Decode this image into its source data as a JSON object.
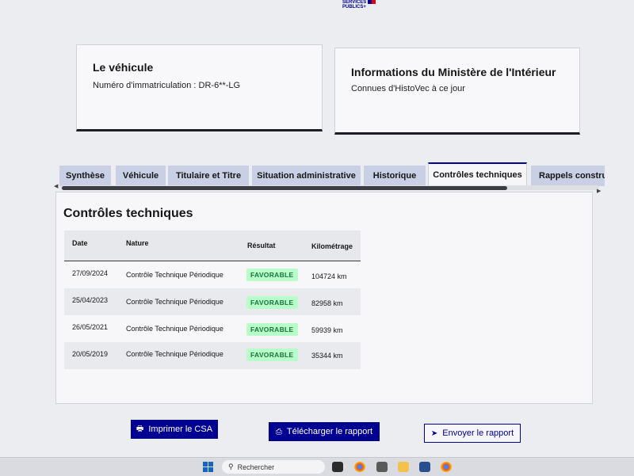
{
  "brand": {
    "line1": "SERVICES",
    "line2": "PUBLICS+"
  },
  "vehicle_card": {
    "title": "Le véhicule",
    "plate_label": "Numéro d'immatriculation : DR-6**-LG"
  },
  "ministry_card": {
    "title": "Informations du Ministère de l'Intérieur",
    "subtitle": "Connues d'HistoVec à ce jour"
  },
  "tabs": [
    {
      "label": "Synthèse",
      "active": false
    },
    {
      "label": "Véhicule",
      "active": false
    },
    {
      "label": "Titulaire et Titre",
      "active": false
    },
    {
      "label": "Situation administrative",
      "active": false
    },
    {
      "label": "Historique",
      "active": false
    },
    {
      "label": "Contrôles techniques",
      "active": true
    },
    {
      "label": "Rappels constru",
      "active": false
    }
  ],
  "panel": {
    "title": "Contrôles techniques",
    "columns": [
      "Date",
      "Nature",
      "Résultat",
      "Kilométrage"
    ],
    "rows": [
      {
        "date": "27/09/2024",
        "nature": "Contrôle Technique Périodique",
        "result": "FAVORABLE",
        "km": "104724 km"
      },
      {
        "date": "25/04/2023",
        "nature": "Contrôle Technique Périodique",
        "result": "FAVORABLE",
        "km": "82958 km"
      },
      {
        "date": "26/05/2021",
        "nature": "Contrôle Technique Périodique",
        "result": "FAVORABLE",
        "km": "59939 km"
      },
      {
        "date": "20/05/2019",
        "nature": "Contrôle Technique Périodique",
        "result": "FAVORABLE",
        "km": "35344 km"
      }
    ]
  },
  "actions": {
    "print": "Imprimer le CSA",
    "download": "Télécharger le rapport",
    "send": "Envoyer le rapport"
  },
  "taskbar": {
    "search_placeholder": "Rechercher"
  },
  "colors": {
    "primary": "#000091",
    "success_text": "#18753c",
    "success_bg": "#b8fec9",
    "tab_bg": "#c9d0e6"
  },
  "icons": [
    "printer-icon",
    "download-icon",
    "send-icon",
    "windows-start-icon",
    "search-icon"
  ]
}
